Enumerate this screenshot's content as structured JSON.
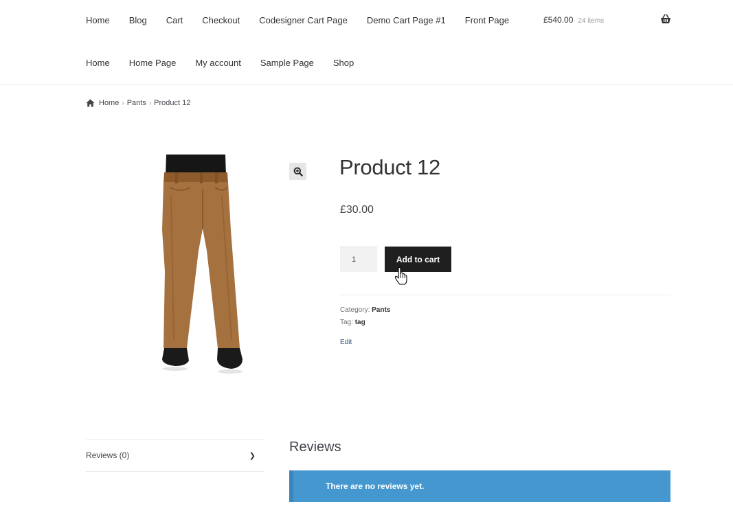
{
  "header": {
    "nav_primary": [
      "Home",
      "Blog",
      "Cart",
      "Checkout",
      "Codesigner Cart Page",
      "Demo Cart Page #1",
      "Front Page"
    ],
    "nav_secondary": [
      "Home",
      "Home Page",
      "My account",
      "Sample Page",
      "Shop"
    ],
    "cart_amount": "£540.00",
    "cart_count": "24 items"
  },
  "breadcrumb": {
    "home": "Home",
    "category": "Pants",
    "current": "Product 12"
  },
  "product": {
    "title": "Product 12",
    "price": "£30.00",
    "quantity": "1",
    "add_to_cart_label": "Add to cart",
    "category_label": "Category:",
    "category_value": "Pants",
    "tag_label": "Tag:",
    "tag_value": "tag",
    "edit_label": "Edit"
  },
  "tabs": {
    "reviews_tab": "Reviews (0)",
    "reviews_heading": "Reviews",
    "no_reviews_notice": "There are no reviews yet."
  },
  "icons": {
    "home": "home-icon",
    "basket": "basket-icon",
    "zoom": "zoom-icon",
    "chevron": "chevron-right-icon"
  },
  "colors": {
    "button_bg": "#1f1f1f",
    "notice_bg": "#4497cf",
    "pants": "#a5713f"
  }
}
